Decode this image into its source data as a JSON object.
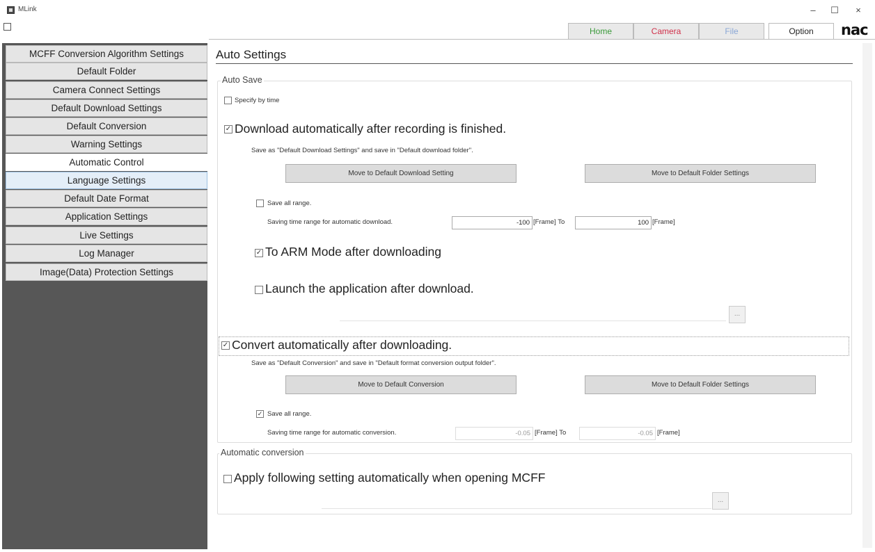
{
  "window": {
    "title": "MLink",
    "controls": {
      "minimize": "–",
      "maximize": "☐",
      "close": "×"
    }
  },
  "tabs": [
    {
      "label": "Home",
      "color": "#3a9a3a"
    },
    {
      "label": "Camera",
      "color": "#d0304a"
    },
    {
      "label": "File",
      "color": "#8aa7d6"
    },
    {
      "label": "Option",
      "color": "#222222"
    }
  ],
  "brand": {
    "logo": "nac"
  },
  "sidebar": {
    "items": [
      {
        "label": "MCFF Conversion Algorithm Settings"
      },
      {
        "label": "Default Folder"
      },
      {
        "label": "Camera Connect Settings"
      },
      {
        "label": "Default Download Settings"
      },
      {
        "label": "Default Conversion"
      },
      {
        "label": "Warning Settings"
      },
      {
        "label": "Automatic Control"
      },
      {
        "label": "Language Settings"
      },
      {
        "label": "Default Date Format"
      },
      {
        "label": "Application Settings"
      },
      {
        "label": "Live Settings"
      },
      {
        "label": "Log Manager"
      },
      {
        "label": "Image(Data) Protection Settings"
      }
    ],
    "selected": "Automatic Control",
    "hovered": "Language Settings"
  },
  "main": {
    "title": "Auto Settings",
    "auto_save": {
      "legend": "Auto Save",
      "specify_by_time": {
        "label": "Specify by time",
        "checked": false
      },
      "download_auto": {
        "label": "Download automatically after recording is finished.",
        "checked": true
      },
      "download_note": "Save as \"Default Download Settings\" and save in \"Default download folder\".",
      "btn_download_setting": "Move to Default Download Setting",
      "btn_folder_settings_1": "Move to Default Folder Settings",
      "save_all_range_1": {
        "label": "Save all range.",
        "checked": false
      },
      "range_download": {
        "label": "Saving time range for automatic download.",
        "from": "-100",
        "from_unit": "[Frame] To",
        "to": "100",
        "to_unit": "[Frame]"
      },
      "arm_mode": {
        "label": "To ARM Mode after downloading",
        "checked": true
      },
      "launch_app": {
        "label": "Launch the application after download.",
        "checked": false
      },
      "browse_1": "...",
      "convert_auto": {
        "label": "Convert automatically after downloading.",
        "checked": true
      },
      "convert_note": "Save as \"Default Conversion\" and save in \"Default format conversion output folder\".",
      "btn_default_conversion": "Move to Default Conversion",
      "btn_folder_settings_2": "Move to Default Folder Settings",
      "save_all_range_2": {
        "label": "Save all range.",
        "checked": true
      },
      "range_conversion": {
        "label": "Saving time range for automatic conversion.",
        "from": "-0.05",
        "from_unit": "[Frame] To",
        "to": "-0.05",
        "to_unit": "[Frame]"
      }
    },
    "automatic_conversion": {
      "legend": "Automatic conversion",
      "apply_mcff": {
        "label": "Apply following setting automatically when opening MCFF",
        "checked": false
      },
      "browse_2": "..."
    }
  },
  "check_glyph": "✓"
}
